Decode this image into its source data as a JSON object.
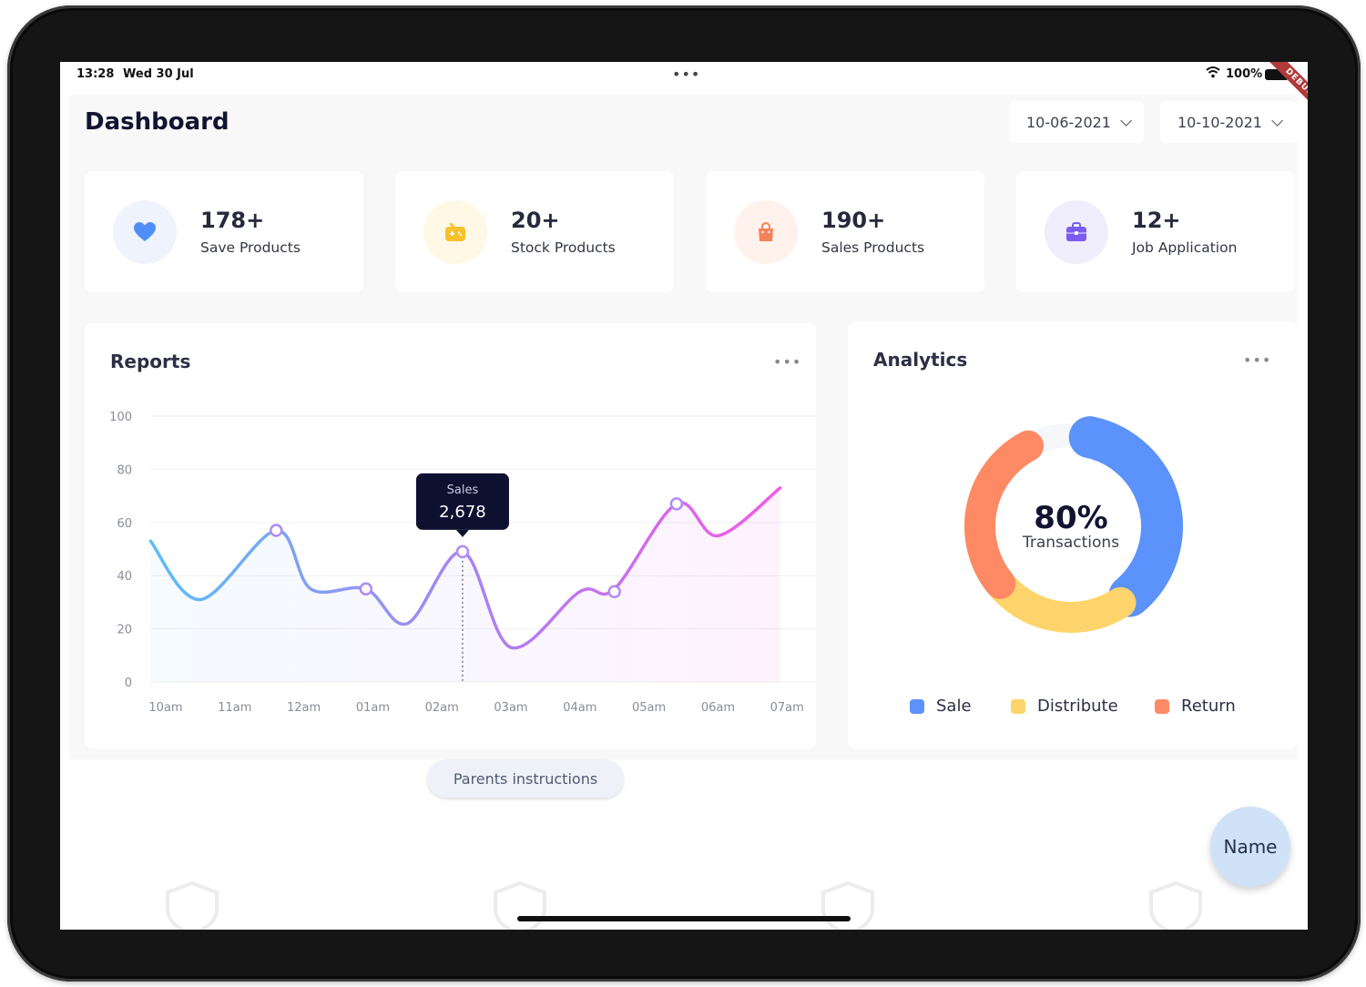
{
  "status_bar": {
    "time": "13:28",
    "date": "Wed 30 Jul",
    "battery": "100%",
    "ribbon": "DEBUG"
  },
  "header": {
    "title": "Dashboard",
    "date_from": "10-06-2021",
    "date_to": "10-10-2021"
  },
  "stats": [
    {
      "value": "178+",
      "label": "Save Products",
      "icon": "heart-icon",
      "icon_color": "#4f8ef7",
      "bg": "#eef3fd"
    },
    {
      "value": "20+",
      "label": "Stock Products",
      "icon": "game-controller-icon",
      "icon_color": "#f7c12a",
      "bg": "#fff8e6"
    },
    {
      "value": "190+",
      "label": "Sales Products",
      "icon": "shopping-bag-icon",
      "icon_color": "#f4835a",
      "bg": "#fff1ec"
    },
    {
      "value": "12+",
      "label": "Job Application",
      "icon": "briefcase-icon",
      "icon_color": "#7b5cf0",
      "bg": "#f0eefc"
    }
  ],
  "reports": {
    "title": "Reports",
    "more": "•••",
    "tooltip": {
      "label": "Sales",
      "value": "2,678"
    }
  },
  "analytics": {
    "title": "Analytics",
    "more": "•••",
    "center_value": "80%",
    "center_label": "Transactions",
    "legend": [
      {
        "label": "Sale",
        "color": "#5b92fb"
      },
      {
        "label": "Distribute",
        "color": "#fdd46b"
      },
      {
        "label": "Return",
        "color": "#fd8a64"
      }
    ]
  },
  "chart_data": {
    "type": "line",
    "x_ticks": [
      "10am",
      "11am",
      "12am",
      "01am",
      "02am",
      "03am",
      "04am",
      "05am",
      "06am",
      "07am"
    ],
    "y_ticks": [
      0,
      20,
      40,
      60,
      80,
      100
    ],
    "ylim": [
      0,
      100
    ],
    "x_range": [
      0,
      9.6
    ],
    "series": [
      {
        "name": "Sales",
        "points": [
          [
            -0.22,
            53
          ],
          [
            0.5,
            31
          ],
          [
            1.6,
            57
          ],
          [
            2.1,
            35
          ],
          [
            2.9,
            35
          ],
          [
            3.5,
            22
          ],
          [
            4.3,
            49
          ],
          [
            5.0,
            13
          ],
          [
            6.0,
            34
          ],
          [
            6.5,
            35
          ],
          [
            7.4,
            67
          ],
          [
            8.0,
            55
          ],
          [
            8.9,
            73
          ]
        ],
        "markers": [
          [
            1.6,
            57
          ],
          [
            2.9,
            35
          ],
          [
            4.3,
            49
          ],
          [
            6.5,
            34
          ],
          [
            7.4,
            67
          ]
        ]
      }
    ],
    "tooltip_x": 4.3
  },
  "donut_data": {
    "type": "pie",
    "segments": [
      {
        "name": "Sale",
        "start_deg": 12,
        "end_deg": 140,
        "color": "#5b92fb"
      },
      {
        "name": "Distribute",
        "start_deg": 147,
        "end_deg": 227,
        "color": "#fdd46b"
      },
      {
        "name": "Return",
        "start_deg": 231,
        "end_deg": 332,
        "color": "#fd8a64"
      }
    ]
  },
  "buttons": {
    "parents": "Parents instructions",
    "name_fab": "Name"
  }
}
